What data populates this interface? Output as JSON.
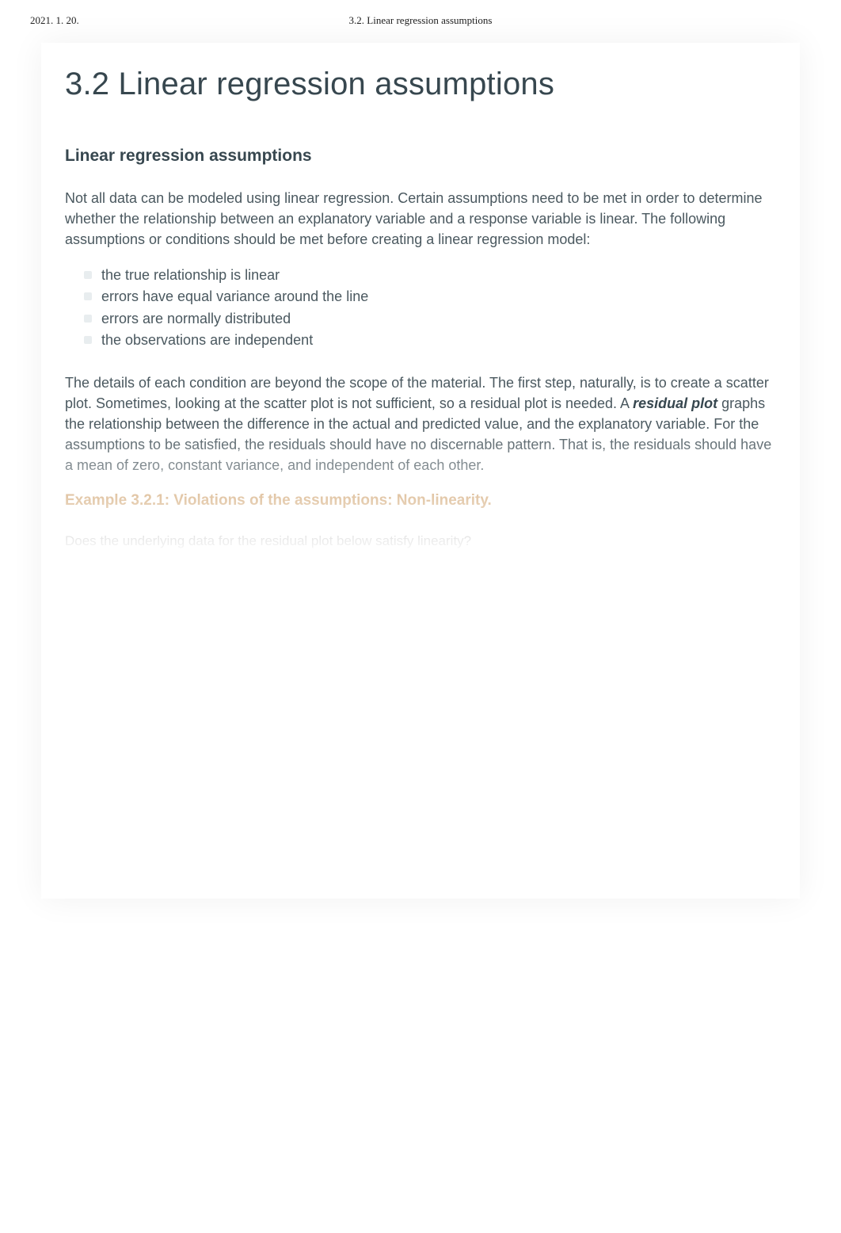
{
  "header": {
    "date": "2021. 1. 20.",
    "title": "3.2. Linear regression assumptions"
  },
  "main": {
    "h1": "3.2 Linear regression assumptions",
    "h2": "Linear regression assumptions",
    "intro": "Not all data can be modeled using linear regression. Certain assumptions need to be met in order to determine whether the relationship between an explanatory variable and a response variable is linear. The following assumptions or conditions should be met before creating a linear regression model:",
    "assumptions": [
      "the true relationship is linear",
      "errors have equal variance around the line",
      "errors are normally distributed",
      "the observations are independent"
    ],
    "para2_a": "The details of each condition are beyond the scope of the material. The first step, naturally, is to create a scatter plot. Sometimes, looking at the scatter plot is not sufficient, so a residual plot is needed. A ",
    "para2_term": "residual plot",
    "para2_b": " graphs the relationship between the difference in the actual and predicted value, and the explanatory variable. For the assumptions to be satisfied, the residuals should have no discernable pattern. That is, the residuals should have a mean of zero, constant variance, and independent of each other.",
    "example": {
      "label": "Example 3.2.1: Violations of the assumptions: Non-linearity.",
      "prompt": "Does the underlying data for the residual plot below satisfy linearity?"
    }
  }
}
